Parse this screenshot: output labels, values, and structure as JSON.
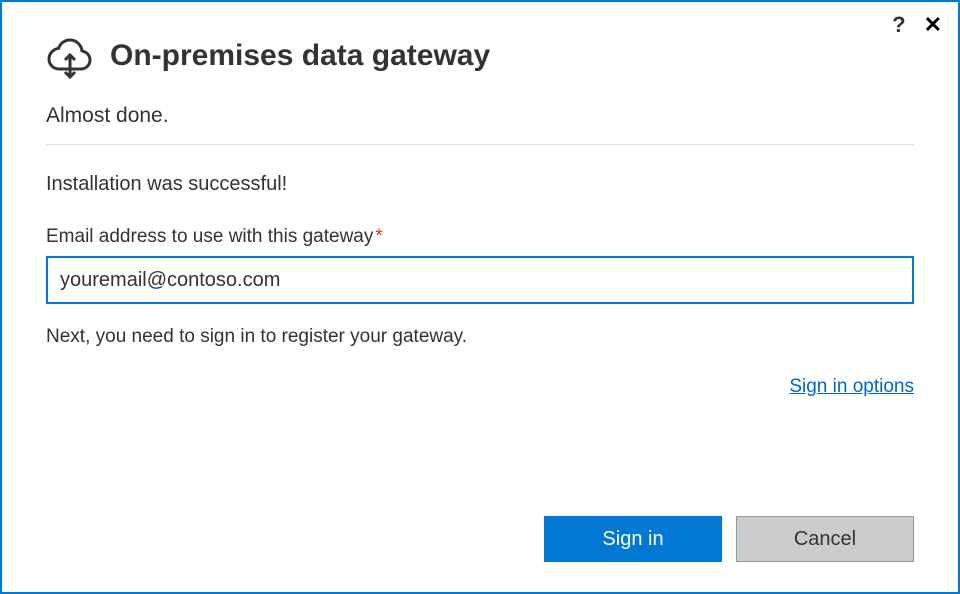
{
  "titlebar": {
    "help_label": "?",
    "close_label": "✕"
  },
  "header": {
    "title": "On-premises data gateway",
    "subtitle": "Almost done."
  },
  "body": {
    "success_message": "Installation was successful!",
    "email_label": "Email address to use with this gateway",
    "required_mark": "*",
    "email_value": "youremail@contoso.com",
    "next_step_text": "Next, you need to sign in to register your gateway.",
    "signin_options_label": "Sign in options"
  },
  "buttons": {
    "primary_label": "Sign in",
    "secondary_label": "Cancel"
  }
}
